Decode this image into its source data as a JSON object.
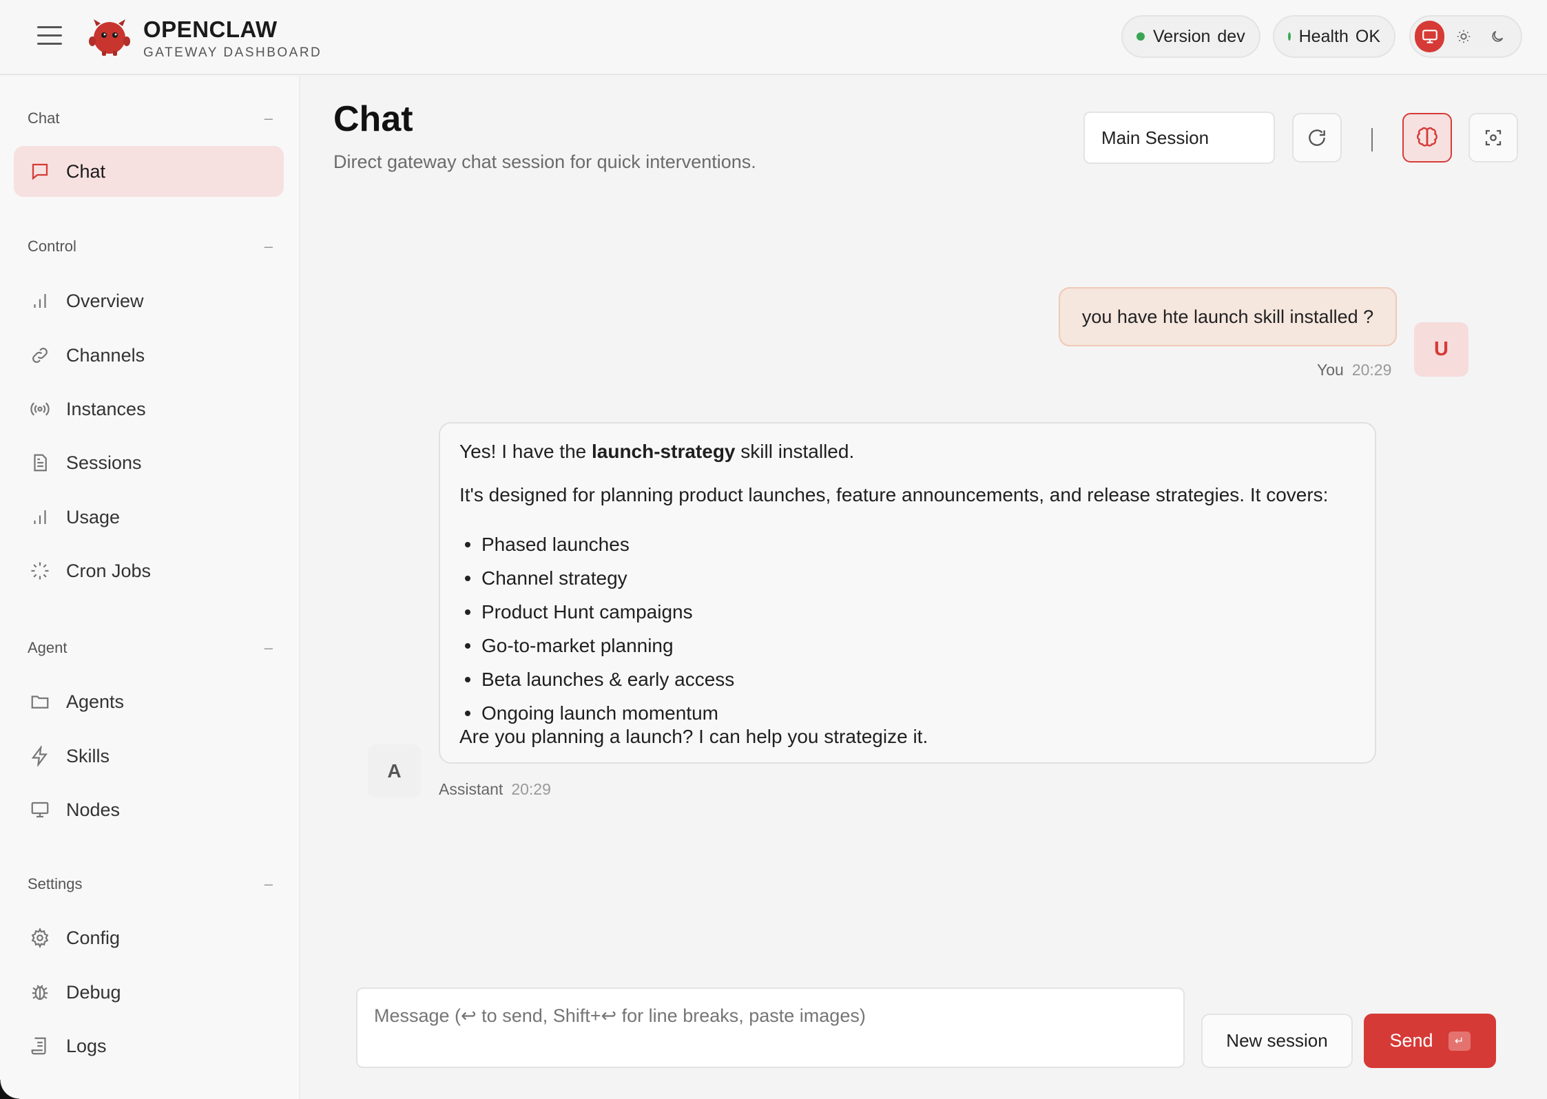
{
  "header": {
    "brand_name": "OPENCLAW",
    "brand_sub": "GATEWAY DASHBOARD",
    "version_label": "Version",
    "version_value": "dev",
    "health_label": "Health",
    "health_value": "OK",
    "status_color": "#3aa655",
    "accent_color": "#d63a36",
    "theme_options": [
      "monitor-icon",
      "sun-icon",
      "moon-icon"
    ]
  },
  "sidebar": {
    "sections": {
      "chat": "Chat",
      "control": "Control",
      "agent": "Agent",
      "settings": "Settings"
    },
    "collapse_glyph": "–",
    "items": {
      "chat": "Chat",
      "overview": "Overview",
      "channels": "Channels",
      "instances": "Instances",
      "sessions": "Sessions",
      "usage": "Usage",
      "cron_jobs": "Cron Jobs",
      "agents": "Agents",
      "skills": "Skills",
      "nodes": "Nodes",
      "config": "Config",
      "debug": "Debug",
      "logs": "Logs"
    },
    "active": "chat"
  },
  "main": {
    "title": "Chat",
    "subtitle": "Direct gateway chat session for quick interventions.",
    "session_select": "Main Session",
    "separator": "|"
  },
  "messages": {
    "user": {
      "text": "you have hte launch skill installed ?",
      "avatar": "U",
      "author": "You",
      "time": "20:29"
    },
    "assistant": {
      "intro_pre": "Yes! I have the ",
      "intro_bold": "launch-strategy",
      "intro_post": " skill installed.",
      "paragraph": "It's designed for planning product launches, feature announcements, and release strategies. It covers:",
      "bullets": [
        "Phased launches",
        "Channel strategy",
        "Product Hunt campaigns",
        "Go-to-market planning",
        "Beta launches & early access",
        "Ongoing launch momentum"
      ],
      "closing": "Are you planning a launch? I can help you strategize it.",
      "avatar": "A",
      "author": "Assistant",
      "time": "20:29"
    }
  },
  "composer": {
    "placeholder": "Message (↩ to send, Shift+↩ for line breaks, paste images)",
    "new_session_label": "New session",
    "send_label": "Send",
    "send_hint": "↵"
  }
}
